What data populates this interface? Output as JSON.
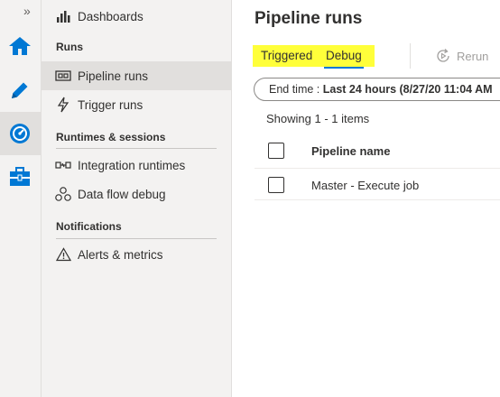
{
  "rail": {
    "collapse_glyph": "»",
    "icons": [
      "home-icon",
      "pencil-icon",
      "monitor-icon",
      "toolbox-icon"
    ]
  },
  "nav": {
    "top_item": {
      "label": "Dashboards",
      "icon": "dashboard-icon"
    },
    "sections": [
      {
        "title": "Runs",
        "items": [
          {
            "label": "Pipeline runs",
            "icon": "pipeline-icon",
            "selected": true
          },
          {
            "label": "Trigger runs",
            "icon": "lightning-icon"
          }
        ]
      },
      {
        "title": "Runtimes & sessions",
        "items": [
          {
            "label": "Integration runtimes",
            "icon": "integration-runtime-icon"
          },
          {
            "label": "Data flow debug",
            "icon": "data-flow-icon"
          }
        ]
      },
      {
        "title": "Notifications",
        "items": [
          {
            "label": "Alerts & metrics",
            "icon": "warning-icon"
          }
        ]
      }
    ]
  },
  "main": {
    "title": "Pipeline runs",
    "tabs": [
      {
        "label": "Triggered"
      },
      {
        "label": "Debug",
        "selected": true
      }
    ],
    "rerun_label": "Rerun",
    "filter": {
      "prefix": "End time : ",
      "value": "Last 24 hours (8/27/20 11:04 AM"
    },
    "showing": "Showing 1 - 1 items",
    "table": {
      "columns": [
        "Pipeline name"
      ],
      "rows": [
        [
          "Master - Execute job"
        ]
      ]
    }
  },
  "colors": {
    "accent": "#0078d4",
    "highlight": "#ffff3a",
    "nav_bg": "#f3f2f1",
    "selected_bg": "#e1dfdd"
  }
}
